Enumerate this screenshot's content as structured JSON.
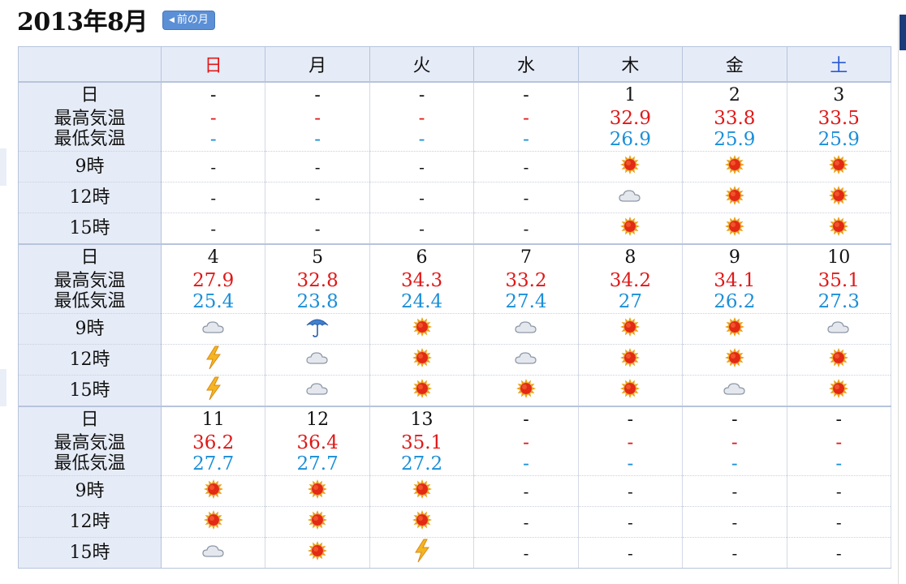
{
  "title": "2013年8月",
  "prev_button": "前の月",
  "weekdays": [
    "日",
    "月",
    "火",
    "水",
    "木",
    "金",
    "土"
  ],
  "row_labels": {
    "date": "日",
    "high_low": [
      "最高気温",
      "最低気温"
    ],
    "times": [
      "9時",
      "12時",
      "15時"
    ]
  },
  "empty": "-",
  "weeks": [
    {
      "dates": [
        "-",
        "-",
        "-",
        "-",
        "1",
        "2",
        "3"
      ],
      "highs": [
        "-",
        "-",
        "-",
        "-",
        "32.9",
        "33.8",
        "33.5"
      ],
      "lows": [
        "-",
        "-",
        "-",
        "-",
        "26.9",
        "25.9",
        "25.9"
      ],
      "weather": [
        [
          "-",
          "-",
          "-",
          "-",
          "sun-icon",
          "sun-icon",
          "sun-icon"
        ],
        [
          "-",
          "-",
          "-",
          "-",
          "cloud-icon",
          "sun-icon",
          "sun-icon"
        ],
        [
          "-",
          "-",
          "-",
          "-",
          "sun-icon",
          "sun-icon",
          "sun-icon"
        ]
      ]
    },
    {
      "dates": [
        "4",
        "5",
        "6",
        "7",
        "8",
        "9",
        "10"
      ],
      "highs": [
        "27.9",
        "32.8",
        "34.3",
        "33.2",
        "34.2",
        "34.1",
        "35.1"
      ],
      "lows": [
        "25.4",
        "23.8",
        "24.4",
        "27.4",
        "27",
        "26.2",
        "27.3"
      ],
      "weather": [
        [
          "cloud-icon",
          "umbrella-icon",
          "sun-icon",
          "cloud-icon",
          "sun-icon",
          "sun-icon",
          "cloud-icon"
        ],
        [
          "lightning-icon",
          "cloud-icon",
          "sun-icon",
          "cloud-icon",
          "sun-icon",
          "sun-icon",
          "sun-icon"
        ],
        [
          "lightning-icon",
          "cloud-icon",
          "sun-icon",
          "sun-icon",
          "sun-icon",
          "cloud-icon",
          "sun-icon"
        ]
      ]
    },
    {
      "dates": [
        "11",
        "12",
        "13",
        "-",
        "-",
        "-",
        "-"
      ],
      "highs": [
        "36.2",
        "36.4",
        "35.1",
        "-",
        "-",
        "-",
        "-"
      ],
      "lows": [
        "27.7",
        "27.7",
        "27.2",
        "-",
        "-",
        "-",
        "-"
      ],
      "weather": [
        [
          "sun-icon",
          "sun-icon",
          "sun-icon",
          "-",
          "-",
          "-",
          "-"
        ],
        [
          "sun-icon",
          "sun-icon",
          "sun-icon",
          "-",
          "-",
          "-",
          "-"
        ],
        [
          "cloud-icon",
          "sun-icon",
          "lightning-icon",
          "-",
          "-",
          "-",
          "-"
        ]
      ]
    }
  ],
  "colors": {
    "high": "#e01818",
    "low": "#1a8fd8",
    "header_bg": "#e6ecf7",
    "sunday": "#e01818",
    "saturday": "#2a5bd6"
  },
  "footer_text": ""
}
